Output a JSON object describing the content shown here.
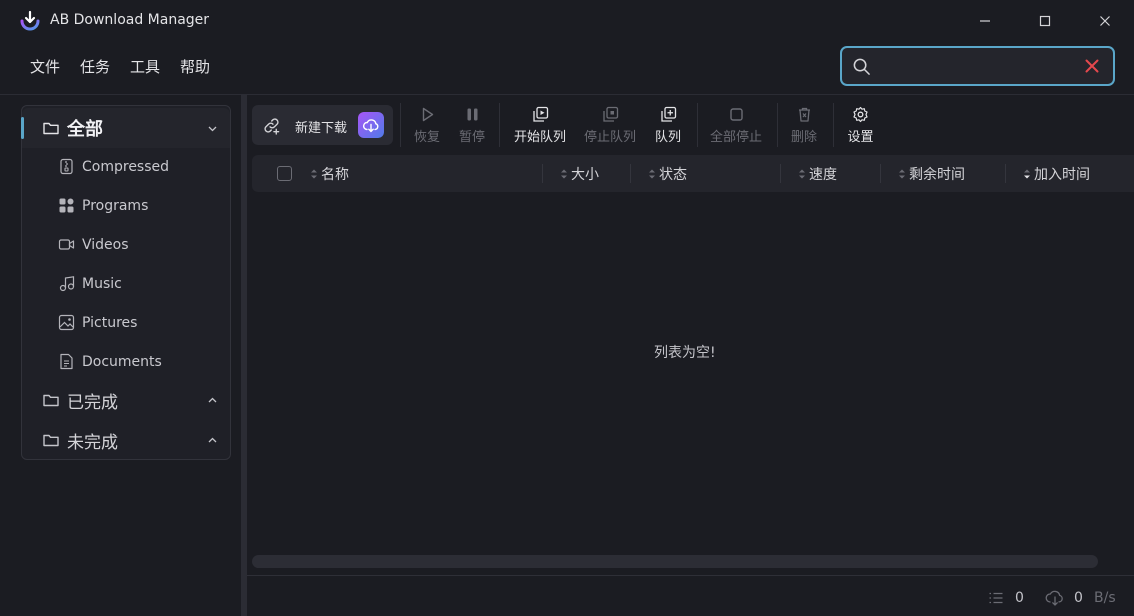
{
  "window": {
    "title": "AB Download Manager"
  },
  "menu": [
    "文件",
    "任务",
    "工具",
    "帮助"
  ],
  "search": {
    "value": "",
    "placeholder": ""
  },
  "categories": {
    "all": {
      "label": "全部",
      "expanded": true,
      "items": [
        {
          "label": "Compressed",
          "icon": "compressed-file-icon"
        },
        {
          "label": "Programs",
          "icon": "programs-icon"
        },
        {
          "label": "Videos",
          "icon": "video-icon"
        },
        {
          "label": "Music",
          "icon": "music-icon"
        },
        {
          "label": "Pictures",
          "icon": "picture-icon"
        },
        {
          "label": "Documents",
          "icon": "document-icon"
        }
      ]
    },
    "finished": {
      "label": "已完成",
      "expanded": false
    },
    "unfinished": {
      "label": "未完成",
      "expanded": false
    }
  },
  "toolbar": {
    "new_download": "新建下载",
    "resume": "恢复",
    "pause": "暂停",
    "start_queue": "开始队列",
    "stop_queue": "停止队列",
    "queue": "队列",
    "stop_all": "全部停止",
    "delete": "删除",
    "settings": "设置"
  },
  "table": {
    "columns": [
      "名称",
      "大小",
      "状态",
      "速度",
      "剩余时间",
      "加入时间"
    ],
    "rows": [],
    "empty_message": "列表为空!"
  },
  "status": {
    "active_count": "0",
    "speed_value": "0",
    "speed_unit": "B/s"
  },
  "colors": {
    "accent": "#5aa6c9",
    "close_red": "#e5484d",
    "background": "#1b1c22"
  }
}
